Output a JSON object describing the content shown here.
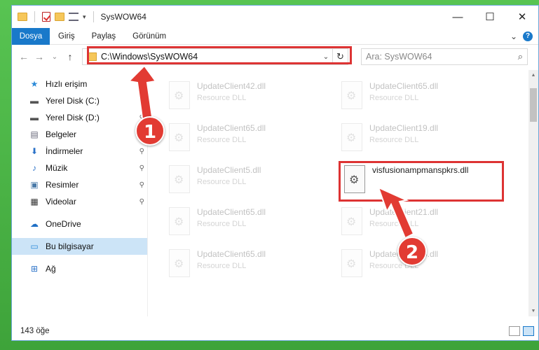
{
  "window": {
    "title": "SysWOW64",
    "controls": {
      "minimize": "—",
      "maximize": "☐",
      "close": "✕"
    }
  },
  "ribbon": {
    "tabs": [
      "Dosya",
      "Giriş",
      "Paylaş",
      "Görünüm"
    ],
    "expand": "⌄",
    "help": "?"
  },
  "nav": {
    "back": "←",
    "forward": "→",
    "recent": "⌄",
    "up": "↑",
    "address": "C:\\Windows\\SysWOW64",
    "dropdown": "⌄",
    "refresh": "↻",
    "search_placeholder": "Ara: SysWOW64",
    "search_icon": "⌕"
  },
  "sidebar": {
    "items": [
      {
        "label": "Hızlı erişim",
        "icon": "star-icon",
        "glyph": "★",
        "color": "#2b8ad8"
      },
      {
        "label": "Yerel Disk (C:)",
        "icon": "drive-icon",
        "glyph": "▬",
        "color": "#555",
        "pinned": true
      },
      {
        "label": "Yerel Disk (D:)",
        "icon": "drive-icon",
        "glyph": "▬",
        "color": "#555",
        "pinned": true
      },
      {
        "label": "Belgeler",
        "icon": "documents-icon",
        "glyph": "▤",
        "color": "#667",
        "pinned": true
      },
      {
        "label": "İndirmeler",
        "icon": "download-icon",
        "glyph": "⬇",
        "color": "#2b72c8",
        "pinned": true
      },
      {
        "label": "Müzik",
        "icon": "music-icon",
        "glyph": "♪",
        "color": "#2b72c8",
        "pinned": true
      },
      {
        "label": "Resimler",
        "icon": "pictures-icon",
        "glyph": "▣",
        "color": "#4a7aa8",
        "pinned": true
      },
      {
        "label": "Videolar",
        "icon": "videos-icon",
        "glyph": "▦",
        "color": "#333",
        "pinned": true
      },
      {
        "label": "OneDrive",
        "icon": "cloud-icon",
        "glyph": "☁",
        "color": "#1f6fc5"
      },
      {
        "label": "Bu bilgisayar",
        "icon": "computer-icon",
        "glyph": "▭",
        "color": "#2b8ad8",
        "selected": true
      },
      {
        "label": "Ağ",
        "icon": "network-icon",
        "glyph": "⊞",
        "color": "#2b72c8"
      }
    ],
    "pin_glyph": "📌"
  },
  "files": [
    {
      "name": "UpdateClient42.dll",
      "type": "Resource DLL",
      "ghost": true
    },
    {
      "name": "UpdateClient65.dll",
      "type": "Resource DLL",
      "ghost": true
    },
    {
      "name": "UpdateClient65.dll",
      "type": "Resource DLL",
      "ghost": true
    },
    {
      "name": "UpdateClient19.dll",
      "type": "Resource DLL",
      "ghost": true
    },
    {
      "name": "UpdateClient5.dll",
      "type": "Resource DLL",
      "ghost": true
    },
    {
      "name": "visfusionampmanspkrs.dll",
      "type": "",
      "ghost": false
    },
    {
      "name": "UpdateClient65.dll",
      "type": "Resource DLL",
      "ghost": true
    },
    {
      "name": "UpdateClient21.dll",
      "type": "Resource DLL",
      "ghost": true
    },
    {
      "name": "UpdateClient65.dll",
      "type": "Resource DLL",
      "ghost": true
    },
    {
      "name": "UpdateClient65.dll",
      "type": "Resource DLL",
      "ghost": true
    }
  ],
  "status": {
    "count": "143 öğe"
  },
  "annotations": {
    "badge1": "1",
    "badge2": "2",
    "accent": "#e23b33"
  },
  "colors": {
    "ribbon_active": "#1979ca",
    "selection": "#cce4f7",
    "highlight_box": "#d33"
  }
}
